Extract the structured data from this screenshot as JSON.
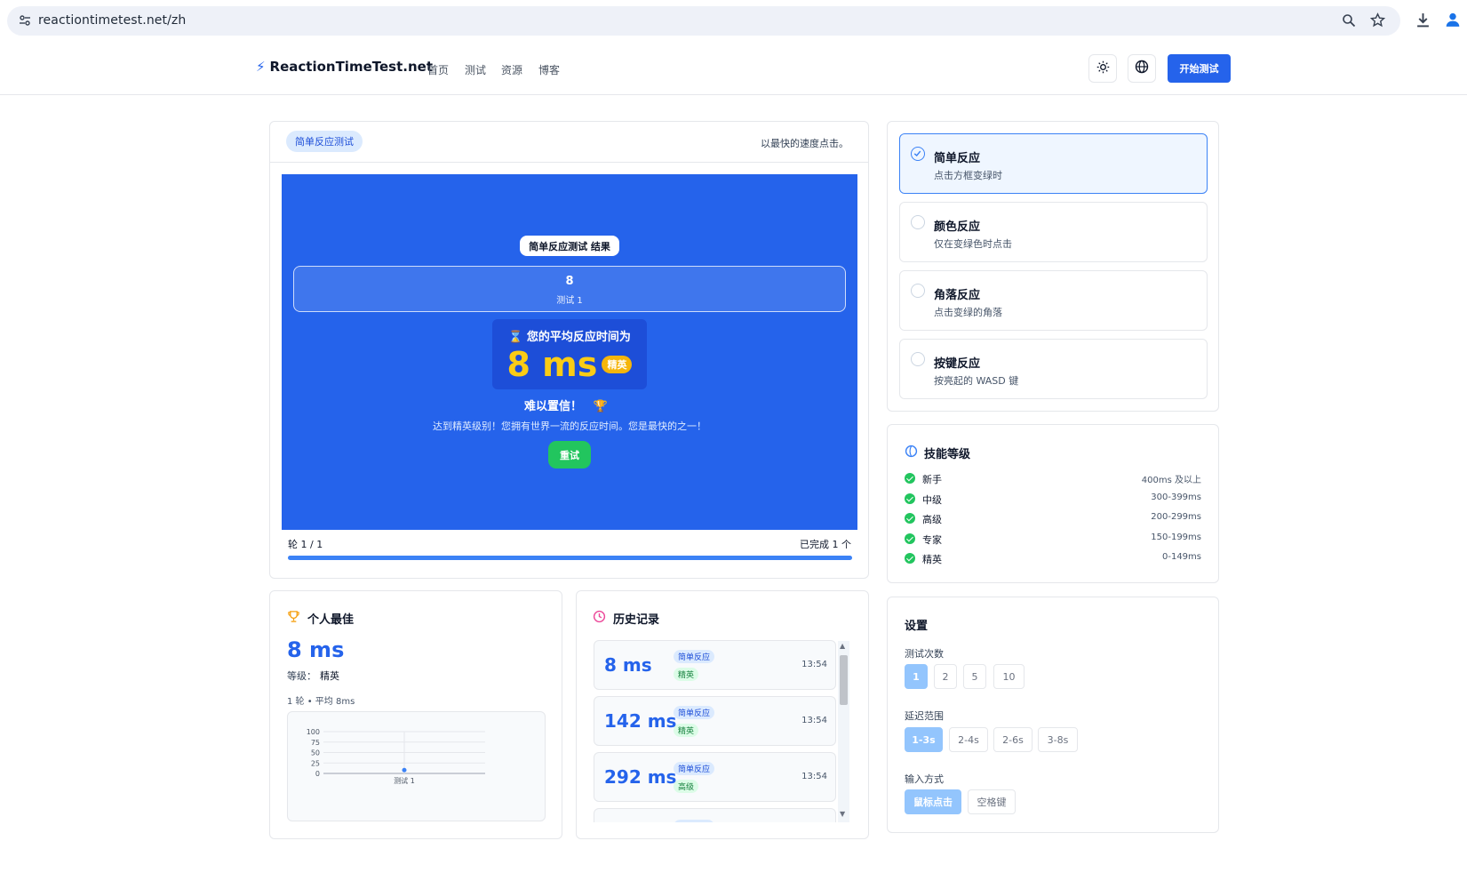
{
  "browser": {
    "url": "reactiontimetest.net/zh",
    "icons": [
      "site-settings-icon",
      "zoom-icon",
      "bookmark-star-icon",
      "download-icon",
      "profile-icon"
    ]
  },
  "header": {
    "logo_text": "ReactionTimeTest.net",
    "nav": [
      "首页",
      "测试",
      "资源",
      "博客"
    ],
    "start_button": "开始测试",
    "colors": {
      "accent": "#2563eb"
    }
  },
  "test": {
    "badge": "简单反应测试",
    "instruction": "以最快的速度点击。",
    "results_title": "简单反应测试 结果",
    "result_value": "8",
    "result_label": "测试 1",
    "avg_title": "⌛ 您的平均反应时间为",
    "avg_value": "8 ms",
    "avg_badge": "精英",
    "verdict_title": "难以置信！",
    "verdict_text": "达到精英级别！您拥有世界一流的反应时间。您是最快的之一！",
    "retry_button": "重试",
    "round_text": "轮 1 / 1",
    "completed_text": "已完成 1 个",
    "progress_fraction": 1.0,
    "colors": {
      "area": "#2563eb",
      "retry": "#22c55e",
      "badge": "#f5b50b"
    }
  },
  "best": {
    "title": "个人最佳",
    "value": "8 ms",
    "level_label": "等级：",
    "level_value": "精英",
    "summary": "1 轮 • 平均 8ms"
  },
  "chart_data": {
    "type": "line",
    "categories": [
      "测试 1"
    ],
    "series": [
      {
        "values": [
          8
        ]
      }
    ],
    "yticks": [
      "100",
      "75",
      "50",
      "25",
      "0"
    ],
    "ylim": [
      0,
      100
    ],
    "xlabel": "",
    "ylabel": "",
    "grid": true
  },
  "history": {
    "title": "历史记录",
    "items": [
      {
        "ms": "8 ms",
        "type": "简单反应",
        "level": "精英",
        "time": "13:54"
      },
      {
        "ms": "142 ms",
        "type": "简单反应",
        "level": "精英",
        "time": "13:54"
      },
      {
        "ms": "292 ms",
        "type": "简单反应",
        "level": "高级",
        "time": "13:54"
      },
      {
        "type": "简单反应"
      }
    ]
  },
  "modes": [
    {
      "title": "简单反应",
      "desc": "点击方框变绿时",
      "selected": true
    },
    {
      "title": "颜色反应",
      "desc": "仅在变绿色时点击",
      "selected": false
    },
    {
      "title": "角落反应",
      "desc": "点击变绿的角落",
      "selected": false
    },
    {
      "title": "按键反应",
      "desc": "按亮起的 WASD 键",
      "selected": false
    }
  ],
  "skills": {
    "title": "技能等级",
    "rows": [
      {
        "name": "新手",
        "range": "400ms 及以上"
      },
      {
        "name": "中级",
        "range": "300-399ms"
      },
      {
        "name": "高级",
        "range": "200-299ms"
      },
      {
        "name": "专家",
        "range": "150-199ms"
      },
      {
        "name": "精英",
        "range": "0-149ms"
      }
    ]
  },
  "settings": {
    "title": "设置",
    "count_label": "测试次数",
    "counts": [
      "1",
      "2",
      "5",
      "10"
    ],
    "count_selected": "1",
    "delay_label": "延迟范围",
    "delays": [
      "1-3s",
      "2-4s",
      "2-6s",
      "3-8s"
    ],
    "delay_selected": "1-3s",
    "input_label": "输入方式",
    "inputs": [
      "鼠标点击",
      "空格键"
    ],
    "input_selected": "鼠标点击"
  }
}
